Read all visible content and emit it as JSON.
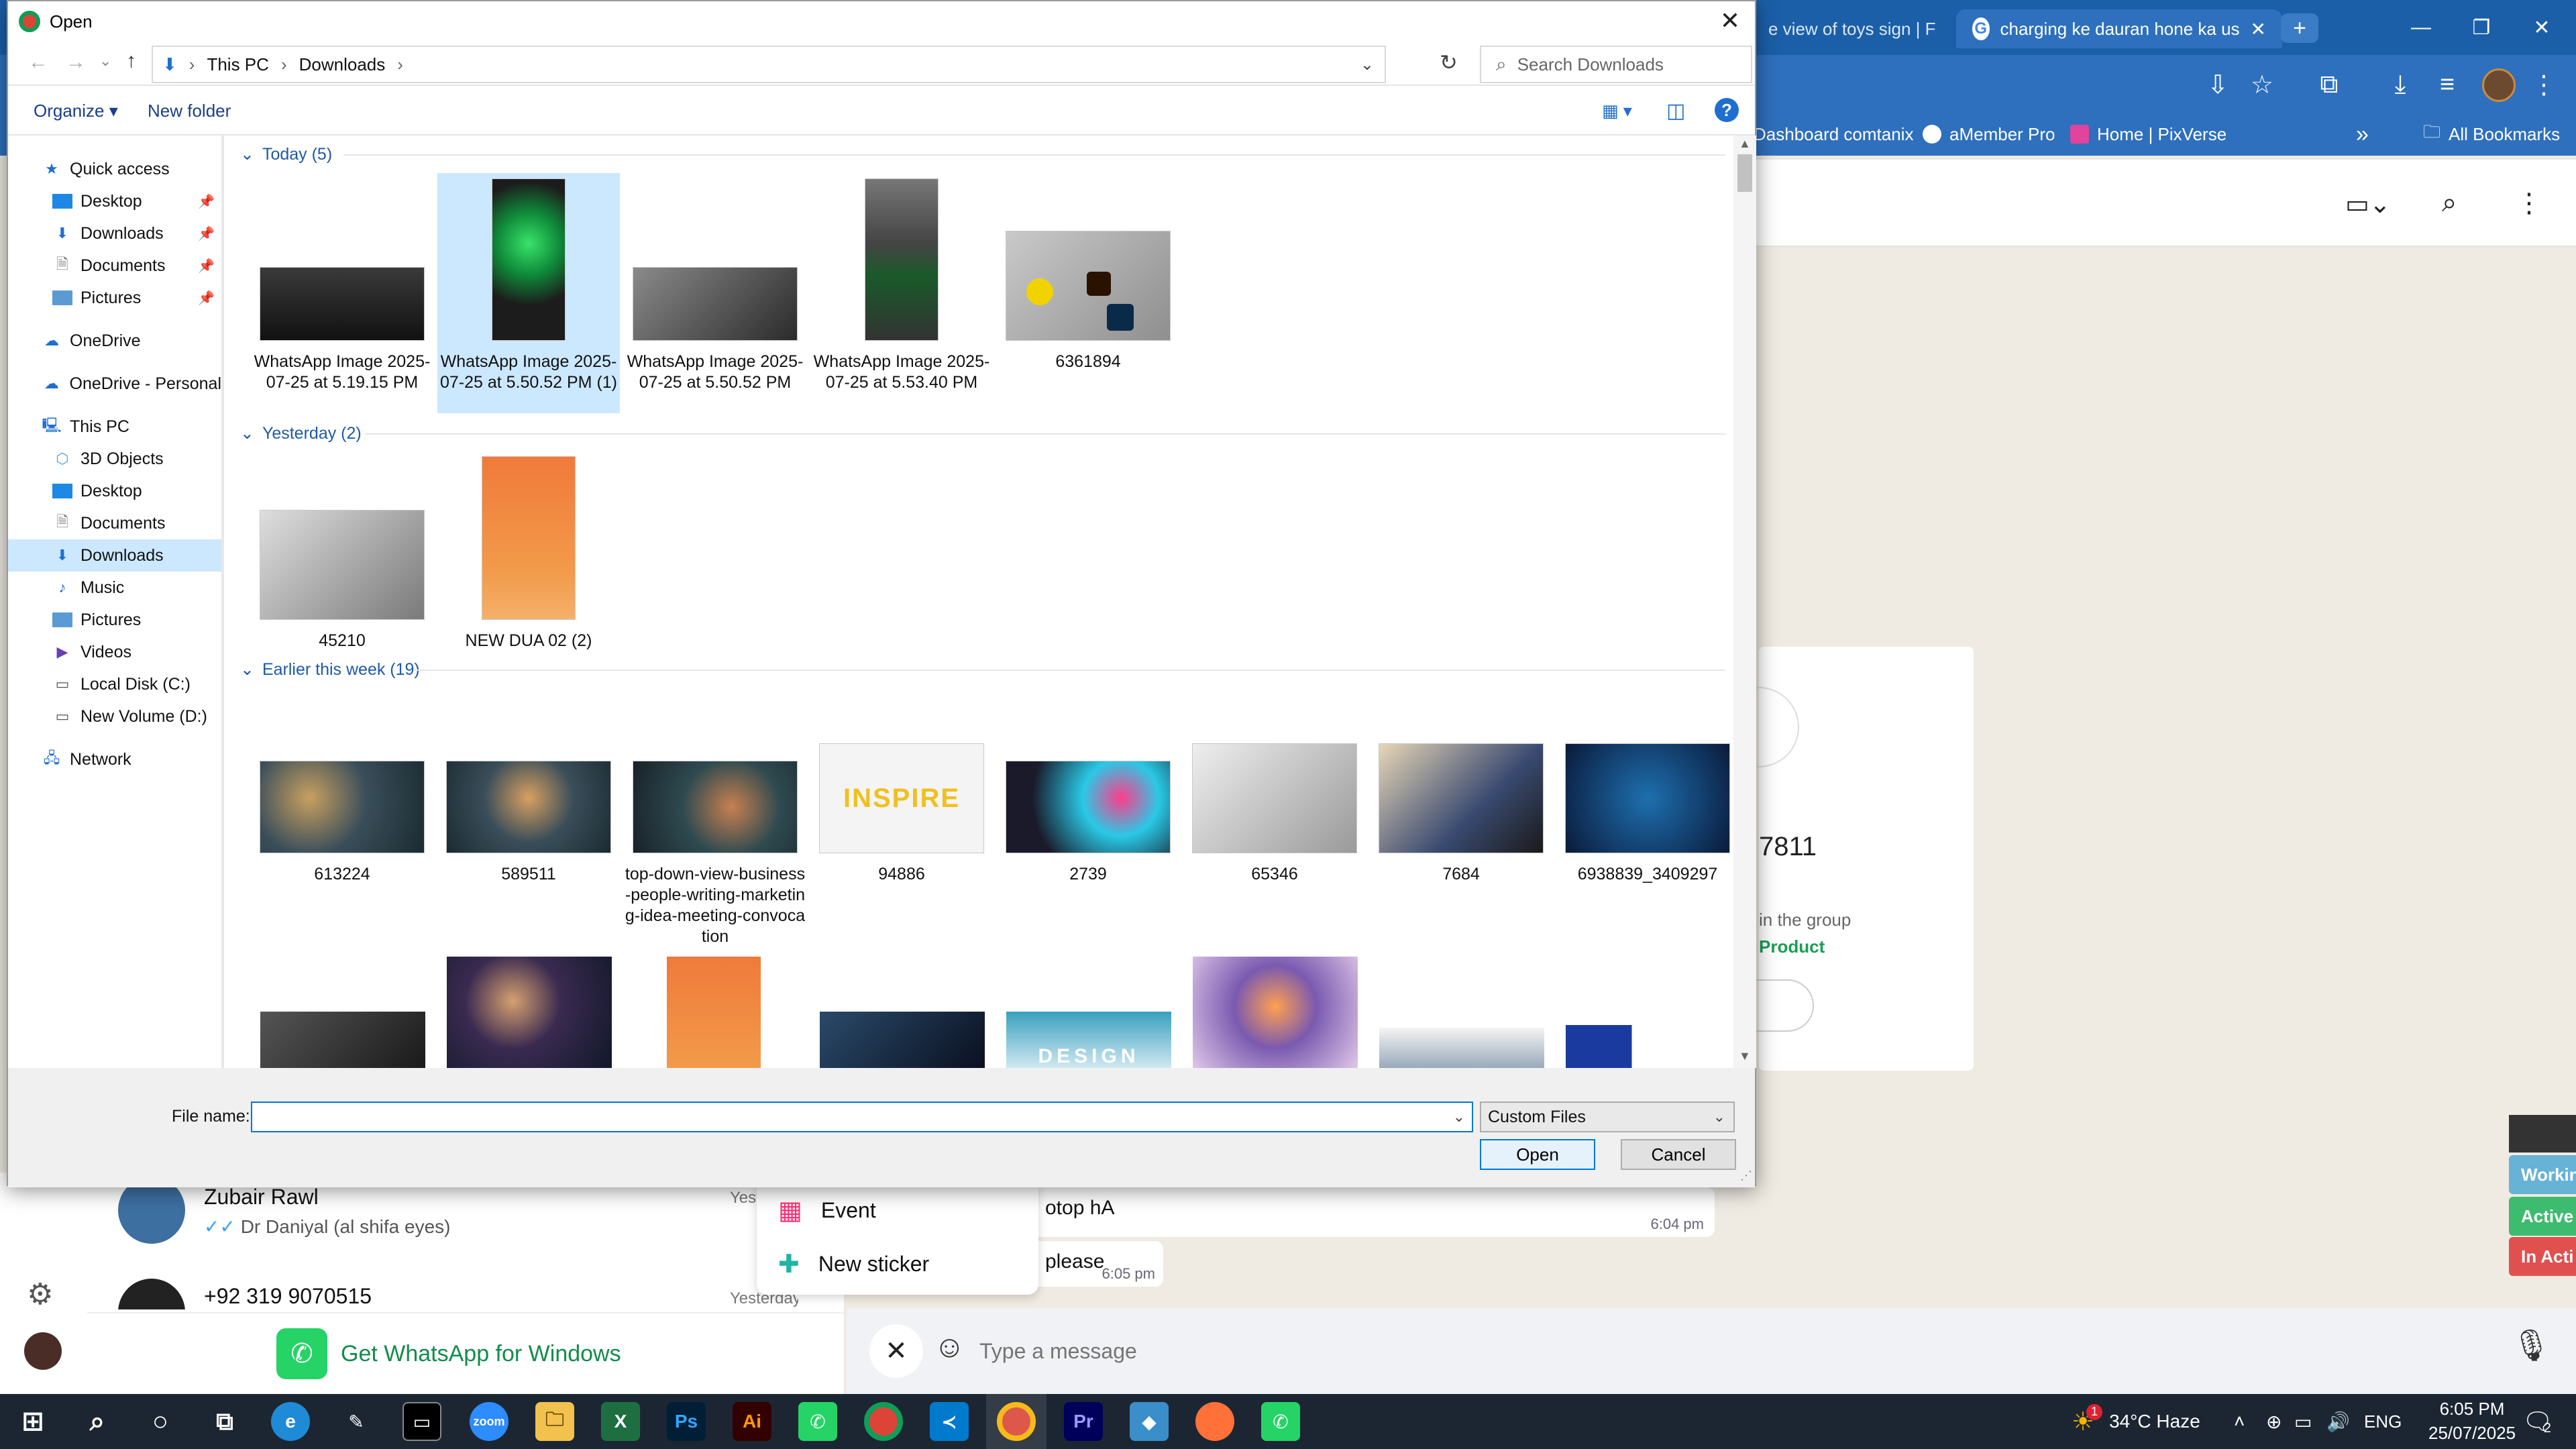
{
  "browser": {
    "tabs": [
      {
        "label": "e view of toys sign | F"
      },
      {
        "label": "charging ke dauran hone ka us"
      }
    ],
    "bookmarks": [
      "Dashboard comtanix",
      "aMember Pro",
      "Home | PixVerse"
    ],
    "all_bookmarks": "All Bookmarks"
  },
  "whatsapp": {
    "card": {
      "number_fragment": "7811",
      "group_text": "in the group",
      "product_link": "Product"
    },
    "messages": [
      {
        "text": "otop hA",
        "time": "6:04 pm"
      },
      {
        "text": "please",
        "time": "6:05 pm"
      }
    ],
    "chats": [
      {
        "name": "Zubair Rawl",
        "preview": "Dr Daniyal (al shifa eyes)",
        "time": "Yest"
      },
      {
        "name": "+92 319 9070515",
        "preview": "",
        "time": "Yesterday"
      }
    ],
    "get_app": "Get WhatsApp for Windows",
    "menu": [
      {
        "label": "Event"
      },
      {
        "label": "New sticker"
      }
    ],
    "message_placeholder": "Type a message",
    "status_labels": [
      {
        "label": "Workin",
        "color": "#66b3d6"
      },
      {
        "label": "Active",
        "color": "#3dbb6e"
      },
      {
        "label": "In Acti",
        "color": "#e0504f"
      }
    ]
  },
  "dialog": {
    "title": "Open",
    "breadcrumb": [
      "This PC",
      "Downloads"
    ],
    "search_placeholder": "Search Downloads",
    "organize_label": "Organize",
    "new_folder_label": "New folder",
    "nav": {
      "quick_access": "Quick access",
      "quick_items": [
        {
          "label": "Desktop"
        },
        {
          "label": "Downloads"
        },
        {
          "label": "Documents"
        },
        {
          "label": "Pictures"
        }
      ],
      "onedrive": "OneDrive",
      "onedrive_personal": "OneDrive - Personal",
      "this_pc": "This PC",
      "pc_items": [
        {
          "label": "3D Objects"
        },
        {
          "label": "Desktop"
        },
        {
          "label": "Documents"
        },
        {
          "label": "Downloads"
        },
        {
          "label": "Music"
        },
        {
          "label": "Pictures"
        },
        {
          "label": "Videos"
        },
        {
          "label": "Local Disk (C:)"
        },
        {
          "label": "New Volume (D:)"
        }
      ],
      "network": "Network"
    },
    "groups": {
      "today": {
        "header": "Today (5)",
        "files": [
          {
            "name": "WhatsApp Image 2025-07-25 at 5.19.15 PM"
          },
          {
            "name": "WhatsApp Image 2025-07-25 at 5.50.52 PM (1)"
          },
          {
            "name": "WhatsApp Image 2025-07-25 at 5.50.52 PM"
          },
          {
            "name": "WhatsApp Image 2025-07-25 at 5.53.40 PM"
          },
          {
            "name": "6361894"
          }
        ]
      },
      "yesterday": {
        "header": "Yesterday (2)",
        "files": [
          {
            "name": "45210"
          },
          {
            "name": "NEW  DUA  02 (2)"
          }
        ]
      },
      "earlier": {
        "header": "Earlier this week (19)",
        "files": [
          {
            "name": "613224"
          },
          {
            "name": "589511"
          },
          {
            "name": "top-down-view-business-people-writing-marketing-idea-meeting-convocation"
          },
          {
            "name": "94886"
          },
          {
            "name": "2739"
          },
          {
            "name": "65346"
          },
          {
            "name": "7684"
          },
          {
            "name": "6938839_3409297"
          }
        ]
      }
    },
    "inspire_text": "INSPIRE",
    "design_text": "DESIGN",
    "file_name_label": "File name:",
    "file_name_value": "",
    "file_type": "Custom Files",
    "open_button": "Open",
    "cancel_button": "Cancel"
  },
  "taskbar": {
    "weather": "34°C  Haze",
    "weather_badge": "1",
    "language": "ENG",
    "time": "6:05 PM",
    "date": "25/07/2025",
    "notifications": "2",
    "app_labels": {
      "zoom": "zoom",
      "excel": "X",
      "photoshop": "Ps",
      "illustrator": "Ai",
      "premiere": "Pr"
    }
  }
}
